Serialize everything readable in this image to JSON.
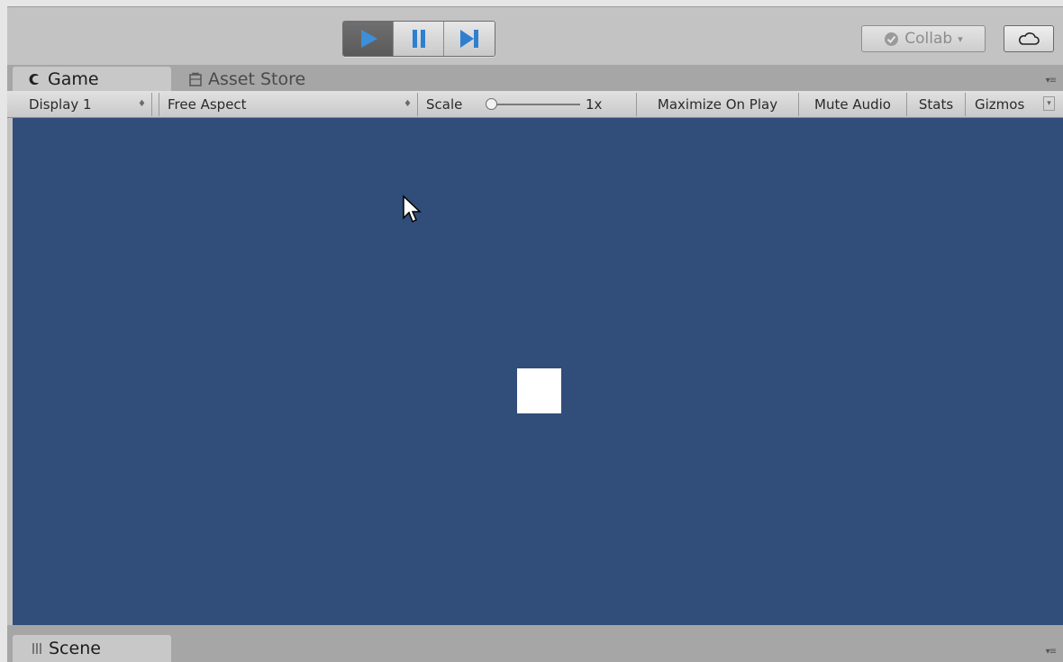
{
  "toolbar": {
    "play_icon": "play-icon",
    "pause_icon": "pause-icon",
    "step_icon": "step-icon",
    "collab_label": "Collab",
    "collab_caret": "▾",
    "cloud_icon": "cloud-icon"
  },
  "tabs": {
    "game": {
      "label": "Game",
      "icon": "game-controller-icon"
    },
    "asset_store": {
      "label": "Asset Store",
      "icon": "store-icon"
    },
    "menu_glyph": "▾≡"
  },
  "game_controls": {
    "display": "Display 1",
    "aspect": "Free Aspect",
    "scale_label": "Scale",
    "scale_value": "1x",
    "maximize": "Maximize On Play",
    "mute": "Mute Audio",
    "stats": "Stats",
    "gizmos": "Gizmos",
    "dropdown_arrows": "♦",
    "gizmos_caret": "▾"
  },
  "bottom": {
    "scene_tab": {
      "label": "Scene",
      "icon": "grid-icon"
    },
    "menu_glyph": "▾≡"
  },
  "colors": {
    "viewport": "#314d79",
    "play_active": "#3d8fd8",
    "toolbar": "#c3c3c3"
  }
}
